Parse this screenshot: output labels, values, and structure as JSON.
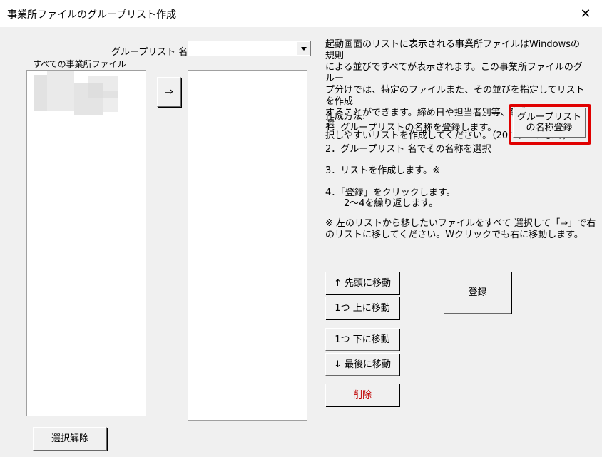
{
  "window": {
    "title": "事業所ファイルのグループリスト作成",
    "close_label": "✕"
  },
  "group_list_label": "グループリスト 名",
  "all_files_label": "すべての事業所ファイル",
  "move_right_label": "⇒",
  "deselect_label": "選択解除",
  "description": [
    "起動画面のリストに表示される事業所ファイルはWindowsの規則",
    "による並びですべてが表示されます。この事業所ファイルのグルー",
    "プ分けでは、特定のファイルまた、その並びを指定してリストを作成",
    "することができます。締め日や担当者別等、事業所ファイルを選",
    "択しやすいリストを作成してください。（20パターンまで）"
  ],
  "method": {
    "heading": "作成方法:",
    "step1": "1．グループリストの名称を登録します。",
    "step2": "2．グループリスト 名でその名称を選択",
    "step3": "3．リストを作成します。※",
    "step4_line1": "4．「登録」をクリックします。",
    "step4_line2": "　　2〜4を繰り返します。",
    "note_line1": "※ 左のリストから移したいファイルをすべて 選択して「⇒」で右",
    "note_line2": "のリストに移してください。Wクリックでも右に移動します。"
  },
  "register_name_button": {
    "line1": "グループリスト",
    "line2": "の名称登録"
  },
  "buttons": {
    "move_top": "↑ 先頭に移動",
    "move_up": "1つ 上に移動",
    "move_down": "1つ 下に移動",
    "move_bottom": "↓ 最後に移動",
    "delete": "削除",
    "register": "登録"
  },
  "colors": {
    "highlight": "#e00000",
    "delete_text": "#c00000"
  }
}
